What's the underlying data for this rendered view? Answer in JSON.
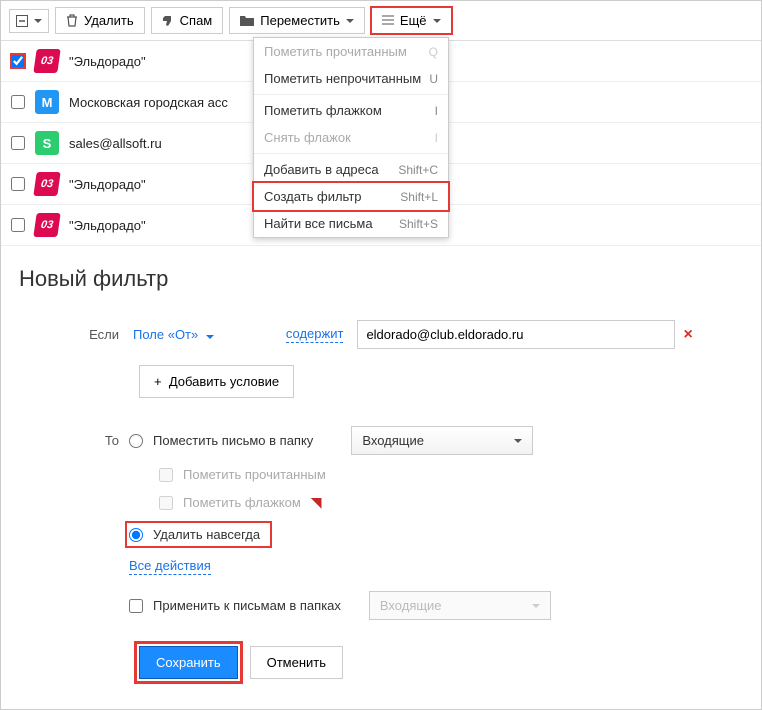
{
  "toolbar": {
    "delete": "Удалить",
    "spam": "Спам",
    "move": "Переместить",
    "more": "Ещё"
  },
  "menu": {
    "mark_read": {
      "label": "Пометить прочитанным",
      "sc": "Q"
    },
    "mark_unread": {
      "label": "Пометить непрочитанным",
      "sc": "U"
    },
    "flag": {
      "label": "Пометить флажком",
      "sc": "I"
    },
    "unflag": {
      "label": "Снять флажок",
      "sc": "I"
    },
    "addr": {
      "label": "Добавить в адреса",
      "sc": "Shift+C"
    },
    "create_filter": {
      "label": "Создать фильтр",
      "sc": "Shift+L"
    },
    "find_all": {
      "label": "Найти все письма",
      "sc": "Shift+S"
    }
  },
  "list": [
    {
      "sender": "\"Эльдорадо\"",
      "avatar": "03",
      "cls": "red",
      "checked": true
    },
    {
      "sender": "Московская городская асс",
      "avatar": "М",
      "cls": "blue",
      "checked": false
    },
    {
      "sender": "sales@allsoft.ru",
      "avatar": "S",
      "cls": "green",
      "checked": false
    },
    {
      "sender": "\"Эльдорадо\"",
      "avatar": "03",
      "cls": "red",
      "checked": false
    },
    {
      "sender": "\"Эльдорадо\"",
      "avatar": "03",
      "cls": "red",
      "checked": false
    }
  ],
  "filter": {
    "title": "Новый фильтр",
    "if_label": "Если",
    "field_from": "Поле «От»",
    "contains": "содержит",
    "value": "eldorado@club.eldorado.ru",
    "add_condition": "Добавить условие",
    "then_label": "То",
    "to_folder": "Поместить письмо в папку",
    "folder": "Входящие",
    "mark_read": "Пометить прочитанным",
    "mark_flag": "Пометить флажком",
    "delete_forever": "Удалить навсегда",
    "all_actions": "Все действия",
    "apply_to": "Применить к письмам в папках",
    "apply_folder": "Входящие",
    "save": "Сохранить",
    "cancel": "Отменить",
    "plus": "+"
  }
}
